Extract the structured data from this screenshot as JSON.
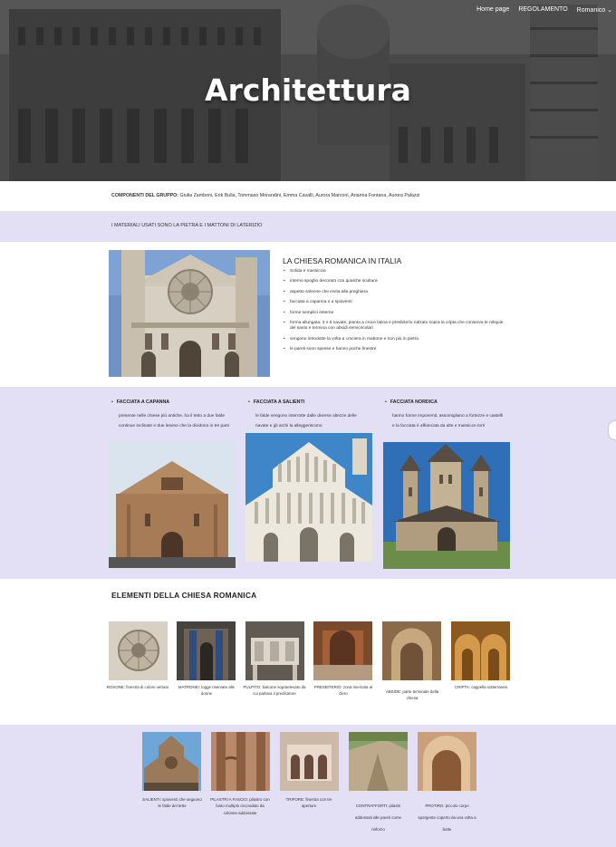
{
  "nav": {
    "items": [
      "Home page",
      "REGOLAMENTO",
      "Romanico"
    ]
  },
  "hero": {
    "title": "Architettura"
  },
  "group": {
    "label": "COMPONENTI DEL GRUPPO:",
    "names": " Giulia Zamboni, Erik Bulla,  Tommaso Morandini, Emma Cavalli, Aurora Marconi, Arianna Fontana, Aurora Palazzi"
  },
  "materials": "I MATERIALI USATI SONO LA PIETRA E I MATTONI DI LATERIZIO",
  "chiesa": {
    "title": "LA CHIESA ROMANICA IN ITALIA",
    "items": [
      "Solida e massiccia",
      "interno spoglio decorato con qualche scultura",
      "aspetto solenne che invita alla preghiera",
      "facciata a capanna o a spioventi",
      "forme semplici esterne",
      "forma allungata, 3 o 5 navate, pianta a croce latina e presbiterio rialzato sopra la cripta che conserva le reliquie del santo e termina con absidi semicircolari",
      "vengono introdotte la volta  a crociera in mattone e non più in pietra",
      "le pareti sono spesse e hanno poche finestre"
    ]
  },
  "facciate": [
    {
      "title": "FACCIATA A CAPANNA",
      "desc": "presente nelle chiese più antiche, ha il tetto a due falde continue inclinate e due lesene che la dividono in tre parti"
    },
    {
      "title": "FACCIATA A SALIENTI",
      "desc": "le falde vengono interrotte dalle diverse altezze delle navate e gli archi la alleggeriscono"
    },
    {
      "title": "FACCIATA NORDICA",
      "desc": "hanno forme imponenti, assomigliano a fortezze e castelli e la facciata è affiancata da alte e massicce torri"
    }
  ],
  "elementi": {
    "title": "ELEMENTI DELLA CHIESA ROMANICA",
    "row1": [
      {
        "name": "ROSONE:",
        "desc": " finestra di colore vetrato"
      },
      {
        "name": "MATRONEI:",
        "desc": " logge riservate alle donne"
      },
      {
        "name": "PULPITO:",
        "desc": " balcone sopraelevato da cui parlava il predicatore"
      },
      {
        "name": "PRESBITERIO:",
        "desc": " zona riservata al clero"
      },
      {
        "name": "ABSIDE:",
        "desc": " parte terminale della chiesa"
      },
      {
        "name": "CRIPTA:",
        "desc": " cappella sotterranea"
      }
    ],
    "row2": [
      {
        "name": "SALIENTI:",
        "desc": " spioventi che seguono le falde del tetto"
      },
      {
        "name": "PILASTRI A FASCIO:",
        "desc": " pilastro con fusto multiplo circondato da colonne addossate"
      },
      {
        "name": "TRIFORE:",
        "desc": " finestra con tre aperture"
      },
      {
        "name": "CONTRAFFORTI:",
        "desc": " pilastri addossati alle pareti come rinforzo"
      },
      {
        "name": "PROTIRO:",
        "desc": " piccolo corpo sporgente coperto da una volta a botte"
      }
    ]
  },
  "colors": {
    "band": "#e3e0f6",
    "hero_text": "#ffffff"
  }
}
